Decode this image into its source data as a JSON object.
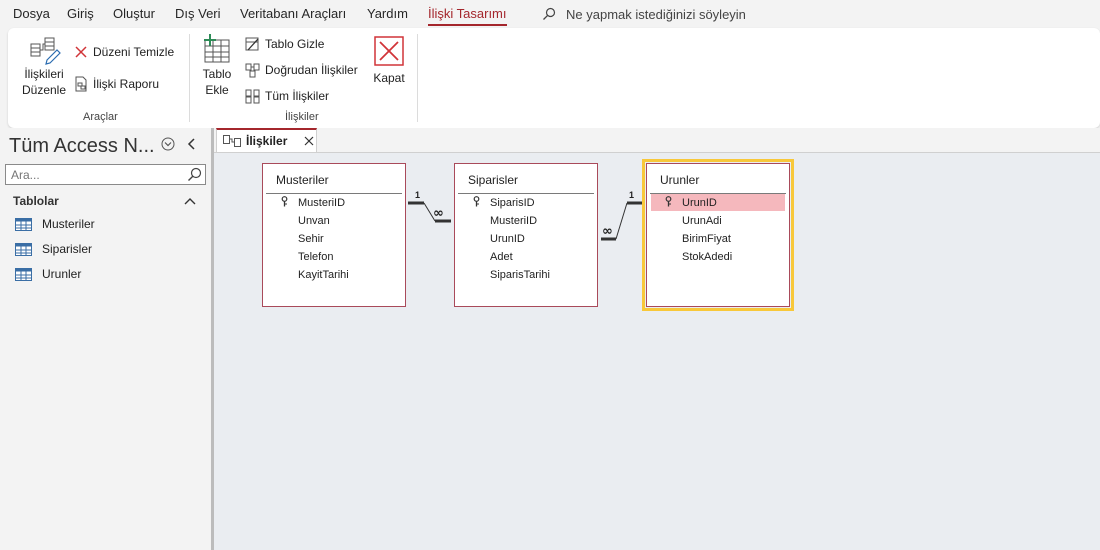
{
  "menu": {
    "items": [
      "Dosya",
      "Giriş",
      "Oluştur",
      "Dış Veri",
      "Veritabanı Araçları",
      "Yardım",
      "İlişki Tasarımı"
    ],
    "active_index": 6,
    "tellme": "Ne yapmak istediğinizi söyleyin"
  },
  "ribbon": {
    "araclar": {
      "edit_relationships_l1": "İlişkileri",
      "edit_relationships_l2": "Düzenle",
      "clear_layout": "Düzeni Temizle",
      "relationship_report": "İlişki Raporu",
      "label": "Araçlar"
    },
    "iliskiler": {
      "add_tables_l1": "Tablo",
      "add_tables_l2": "Ekle",
      "hide_table": "Tablo Gizle",
      "direct_relationships": "Doğrudan İlişkiler",
      "all_relationships": "Tüm İlişkiler",
      "close": "Kapat",
      "label": "İlişkiler"
    }
  },
  "nav": {
    "title": "Tüm Access N...",
    "search_placeholder": "Ara...",
    "section": "Tablolar",
    "tables": [
      "Musteriler",
      "Siparisler",
      "Urunler"
    ]
  },
  "document": {
    "tab_label": "İlişkiler"
  },
  "relationship_tables": [
    {
      "name": "Musteriler",
      "fields": [
        "MusteriID",
        "Unvan",
        "Sehir",
        "Telefon",
        "KayitTarihi"
      ],
      "key_field": "MusteriID",
      "selected": false
    },
    {
      "name": "Siparisler",
      "fields": [
        "SiparisID",
        "MusteriID",
        "UrunID",
        "Adet",
        "SiparisTarihi"
      ],
      "key_field": "SiparisID",
      "selected": false
    },
    {
      "name": "Urunler",
      "fields": [
        "UrunID",
        "UrunAdi",
        "BirimFiyat",
        "StokAdedi"
      ],
      "key_field": "UrunID",
      "selected": true,
      "selected_field": "UrunID"
    }
  ],
  "relationships": [
    {
      "from": "Musteriler.MusteriID",
      "to": "Siparisler.MusteriID",
      "one_label": "1",
      "many_label": "∞"
    },
    {
      "from": "Urunler.UrunID",
      "to": "Siparisler.UrunID",
      "one_label": "1",
      "many_label": "∞"
    }
  ],
  "colors": {
    "accent": "#a4262c",
    "selection": "#f8c83a",
    "table_border": "#a94a5a",
    "field_highlight": "#f5b8bd"
  }
}
